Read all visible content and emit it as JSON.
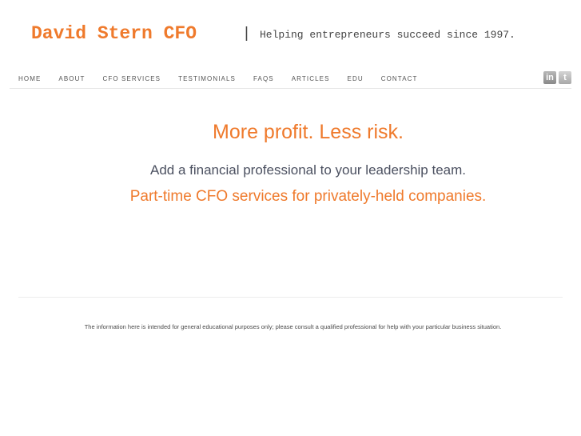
{
  "header": {
    "site_title": "David Stern CFO",
    "separator": "|",
    "tagline": "Helping entrepreneurs succeed since 1997."
  },
  "nav": {
    "items": [
      {
        "label": "HOME"
      },
      {
        "label": "ABOUT"
      },
      {
        "label": "CFO SERVICES"
      },
      {
        "label": "TESTIMONIALS"
      },
      {
        "label": "FAQS"
      },
      {
        "label": "ARTICLES"
      },
      {
        "label": "EDU"
      },
      {
        "label": "CONTACT"
      }
    ]
  },
  "social": {
    "linkedin": {
      "icon": "linkedin-icon",
      "glyph": "in"
    },
    "twitter": {
      "icon": "twitter-icon",
      "glyph": "t"
    }
  },
  "main": {
    "headline": "More profit. Less risk.",
    "subline": "Add a financial professional to your leadership team.",
    "services": "Part-time CFO services for privately-held companies."
  },
  "footer": {
    "disclaimer": "The information here is intended for general educational purposes only; please consult a qualified professional for help with your particular business situation."
  },
  "colors": {
    "accent": "#ef7a2c",
    "text": "#4b5060",
    "divider": "#e6e6e6"
  }
}
